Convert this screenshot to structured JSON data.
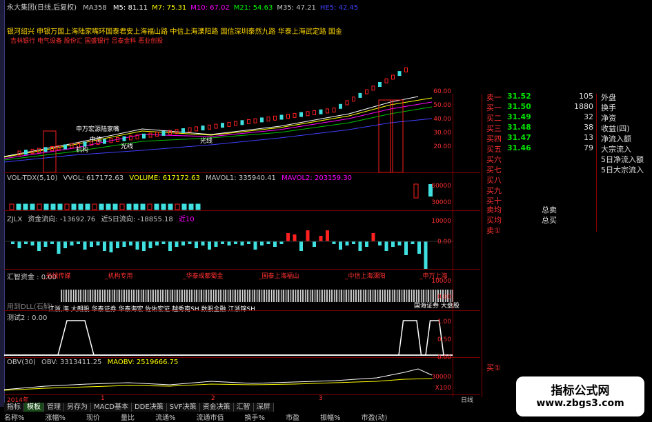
{
  "header": {
    "stock": "永大集团(日线,后复权)",
    "ma_label": "MA358",
    "ma_items": [
      {
        "label": "M5: 81.11",
        "color": "#ffffff"
      },
      {
        "label": "M7: 75.31",
        "color": "#ffff00"
      },
      {
        "label": "M10: 67.02",
        "color": "#ff00ff"
      },
      {
        "label": "M21: 54.63",
        "color": "#00ff00"
      },
      {
        "label": "M35: 47.21",
        "color": "#c8c8c8"
      },
      {
        "label": "HE5: 42.45",
        "color": "#4040ff"
      }
    ],
    "brokers": "银河绍兴 申银万国上海陆家嘴环国泰君安上海福山路 中信上海溧阳路 国信深圳泰然九路 华泰上海武定路 国金",
    "tags": "吉林银行 电气设备 股份汇 国盛银行 吕泰金科 恶业创投"
  },
  "price_axis": [
    "60.00",
    "50.00",
    "40.00",
    "30.00",
    "20.00"
  ],
  "price_annotations": [
    "申万宏源陆家嘴",
    "中信",
    "机构",
    "光线",
    "光线"
  ],
  "vol_panel": {
    "name": "VOL-TDX(5,10)",
    "vvol": "VVOL: 617172.63",
    "volume": "VOLUME: 617172.63",
    "mavol1": "MAVOL1: 335940.41",
    "mavol2": "MAVOL2: 203159.30",
    "axis": [
      "60000",
      "30000"
    ]
  },
  "zjlx_panel": {
    "name": "ZJLX",
    "flow": "资金流向: -13692.76",
    "flow5": "近5日流向: -18855.18",
    "extra": "近10",
    "axis": [
      "10000",
      "0.00"
    ]
  },
  "hz_panel": {
    "name": "汇智资金 : 0.00",
    "labels": [
      "光线传媒",
      "机构专用",
      "华泰成都蜀金",
      "国泰上海福山",
      "中信上海溧阳",
      "申万上海"
    ],
    "axis": [
      "10000",
      "0.00"
    ],
    "left_label": "用到DLL(石斛)",
    "bottom_text": "江浙,海 大朗股 华泰证券 华泰海宏 佐佑宏证 越秀南SH 数股全融 江浙锦SH",
    "right_text": "国海证券 大盘股"
  },
  "test_panel": {
    "name": "测试2 : 0.00",
    "axis": [
      "1.00",
      "0.50",
      "0.00"
    ],
    "pulses": [
      [
        0.12,
        0.14,
        0.18,
        0.2
      ],
      [
        0.88,
        0.89,
        0.92,
        0.93
      ],
      [
        0.94,
        0.95,
        0.97,
        0.98
      ]
    ]
  },
  "obv_panel": {
    "name": "OBV(30)",
    "obv": "OBV: 3313411.25",
    "maobv": "MAOBV: 2519666.75",
    "axis": [
      "30000",
      "X100"
    ],
    "months": [
      "2014年",
      "1",
      "2",
      "3"
    ],
    "period": "日线"
  },
  "right_panel": {
    "buy_rows": [
      {
        "label": "卖一",
        "price": "31.52",
        "qty": "105",
        "extra": "外盘"
      },
      {
        "label": "买一",
        "price": "31.50",
        "qty": "1880",
        "extra": "换手"
      },
      {
        "label": "买二",
        "price": "31.49",
        "qty": "32",
        "extra": "净资"
      },
      {
        "label": "买三",
        "price": "31.48",
        "qty": "38",
        "extra": "收益(四)"
      },
      {
        "label": "买四",
        "price": "31.47",
        "qty": "13",
        "extra": "净流入额"
      },
      {
        "label": "买五",
        "price": "31.46",
        "qty": "79",
        "extra": "大宗流入"
      },
      {
        "label": "买六",
        "price": "",
        "qty": "",
        "extra": "5日净流入额"
      },
      {
        "label": "买七",
        "price": "",
        "qty": "",
        "extra": "5日大宗流入"
      },
      {
        "label": "买八",
        "price": "",
        "qty": "",
        "extra": ""
      },
      {
        "label": "买九",
        "price": "",
        "qty": "",
        "extra": ""
      },
      {
        "label": "买十",
        "price": "",
        "qty": "",
        "extra": ""
      }
    ],
    "sell_avg": "卖均",
    "buy_avg": "买均",
    "total_sell": "总卖",
    "total_buy": "总买",
    "sell1_circle": "卖①",
    "buy1_circle": "买①"
  },
  "tabs": [
    "指标",
    "模板",
    "管理",
    "另存为",
    "MACD基本",
    "DDE决策",
    "SVF决策",
    "资金决策",
    "汇智",
    "深屏"
  ],
  "active_tab": "模板",
  "bottom_columns": [
    "名称%",
    "涨幅%",
    "现价",
    "量比",
    "流通%",
    "流通市值",
    "换手%",
    "市盈",
    "振幅%",
    "市盈(动)"
  ],
  "watermark": {
    "title": "指标公式网",
    "url": "www.zbgs3.com"
  },
  "colors": {
    "up": "#ff2020",
    "down": "#40e0e0",
    "grid": "#8a0000"
  }
}
